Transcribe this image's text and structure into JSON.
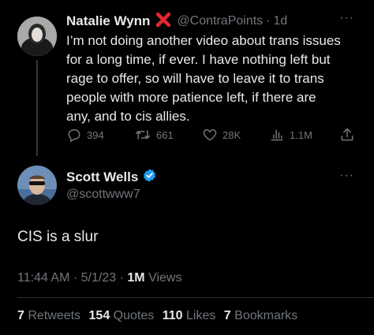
{
  "parent_tweet": {
    "author_name": "Natalie Wynn",
    "handle": "@ContraPoints",
    "separator": "·",
    "age": "1d",
    "more": "···",
    "text_lines": [
      "I’m not doing another video about trans issues",
      "for a long time, if ever. I have nothing left but",
      "rage to offer, so will have to leave it to trans",
      "people with more patience left, if there are",
      "any, and to cis allies."
    ],
    "actions": {
      "replies": "394",
      "retweets": "661",
      "likes": "28K",
      "views": "1.1M"
    }
  },
  "main_tweet": {
    "author_name": "Scott Wells",
    "handle": "@scottwww7",
    "more": "···",
    "text": "CIS is a slur",
    "meta": {
      "time": "11:44 AM",
      "sep1": "·",
      "date": "5/1/23",
      "sep2": "·",
      "views_count": "1M",
      "views_label": "Views"
    },
    "stats": [
      {
        "count": "7",
        "label": "Retweets"
      },
      {
        "count": "154",
        "label": "Quotes"
      },
      {
        "count": "110",
        "label": "Likes"
      },
      {
        "count": "7",
        "label": "Bookmarks"
      }
    ]
  },
  "colors": {
    "background": "#000000",
    "text": "#e7e9ea",
    "muted": "#71767b",
    "verified": "#1d9bf0",
    "cross": "#e0282e",
    "divider": "#2f3336"
  },
  "icons": {
    "reply": "reply-icon",
    "retweet": "retweet-icon",
    "like": "heart-icon",
    "views": "analytics-icon",
    "share": "share-icon",
    "verified": "verified-badge-icon",
    "cross": "red-x-icon"
  }
}
